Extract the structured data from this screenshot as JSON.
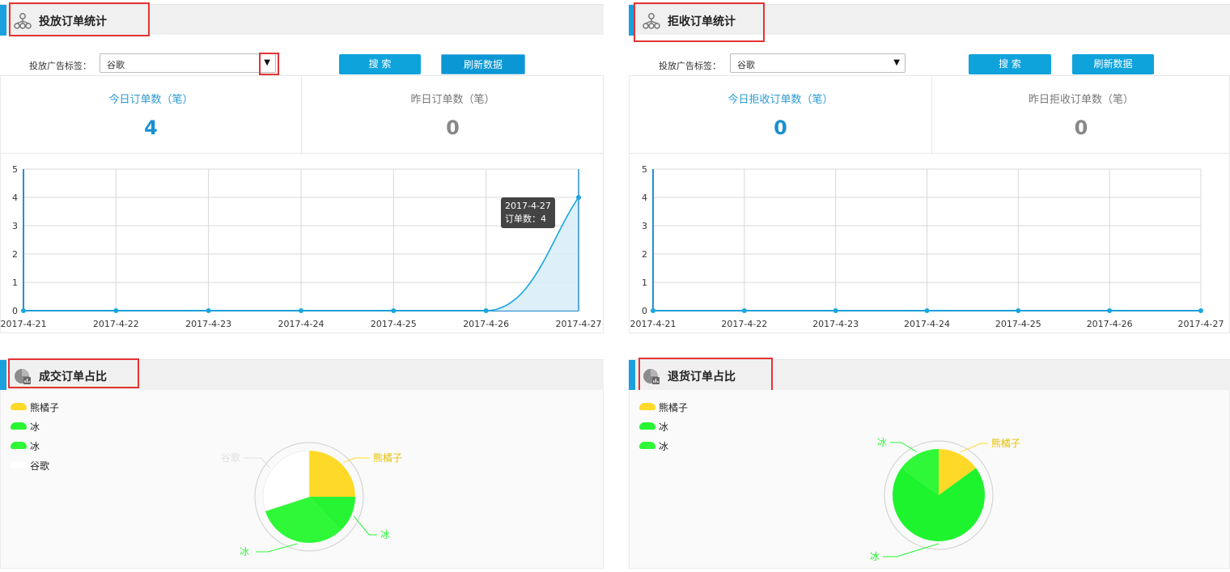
{
  "colors": {
    "accent": "#1aa0dc",
    "button": "#0fa3dc",
    "line": "#1aa6dd",
    "area": "#d9eef9",
    "yellow": "#ffd928",
    "green": "#27f534",
    "green2": "#2ef838",
    "white": "#ffffff",
    "highlight_box": "#e53333"
  },
  "left_order_panel": {
    "title": "投放订单统计",
    "icon": "org-tree-icon",
    "filter_label": "投放广告标签：",
    "select_value": "谷歌",
    "search_label": "搜 索",
    "refresh_label": "刷新数据",
    "today_label": "今日订单数（笔）",
    "today_value": "4",
    "yesterday_label": "昨日订单数（笔）",
    "yesterday_value": "0",
    "tooltip_date": "2017-4-27",
    "tooltip_value": "订单数：4"
  },
  "right_order_panel": {
    "title": "拒收订单统计",
    "icon": "org-tree-icon",
    "filter_label": "投放广告标签：",
    "select_value": "谷歌",
    "search_label": "搜 索",
    "refresh_label": "刷新数据",
    "today_label": "今日拒收订单数（笔）",
    "today_value": "0",
    "yesterday_label": "昨日拒收订单数（笔）",
    "yesterday_value": "0"
  },
  "left_pie_panel": {
    "title": "成交订单占比",
    "icon": "pie-chart-icon",
    "legend": [
      "熊橘子",
      "冰",
      "冰",
      "谷歌"
    ]
  },
  "right_pie_panel": {
    "title": "退货订单占比",
    "icon": "pie-chart-icon",
    "legend": [
      "熊橘子",
      "冰",
      "冰"
    ]
  },
  "chart_data": [
    {
      "type": "area",
      "categories": [
        "2017-4-21",
        "2017-4-22",
        "2017-4-23",
        "2017-4-24",
        "2017-4-25",
        "2017-4-26",
        "2017-4-27"
      ],
      "y_ticks": [
        "0",
        "1",
        "2",
        "3",
        "4",
        "5"
      ],
      "ylim": [
        0,
        5
      ],
      "grid": true,
      "series": [
        {
          "values": [
            0,
            0,
            0,
            0,
            0,
            0,
            4
          ]
        }
      ]
    },
    {
      "type": "line",
      "categories": [
        "2017-4-21",
        "2017-4-22",
        "2017-4-23",
        "2017-4-24",
        "2017-4-25",
        "2017-4-26",
        "2017-4-27"
      ],
      "y_ticks": [
        "0",
        "1",
        "2",
        "3",
        "4",
        "5"
      ],
      "ylim": [
        0,
        5
      ],
      "grid": true,
      "series": [
        {
          "values": [
            0,
            0,
            0,
            0,
            0,
            0,
            0
          ]
        }
      ]
    },
    {
      "type": "pie",
      "slices": [
        {
          "label": "熊橘子",
          "value": 25,
          "color": "#ffd928"
        },
        {
          "label": "冰",
          "value": 13,
          "color": "#27f534"
        },
        {
          "label": "冰",
          "value": 32,
          "color": "#2ef838"
        },
        {
          "label": "谷歌",
          "value": 30,
          "color": "#ffffff"
        }
      ]
    },
    {
      "type": "pie",
      "slices": [
        {
          "label": "熊橘子",
          "value": 15,
          "color": "#ffd928"
        },
        {
          "label": "冰",
          "value": 70,
          "color": "#1ef42e"
        },
        {
          "label": "冰",
          "value": 15,
          "color": "#2ef838"
        }
      ]
    }
  ]
}
